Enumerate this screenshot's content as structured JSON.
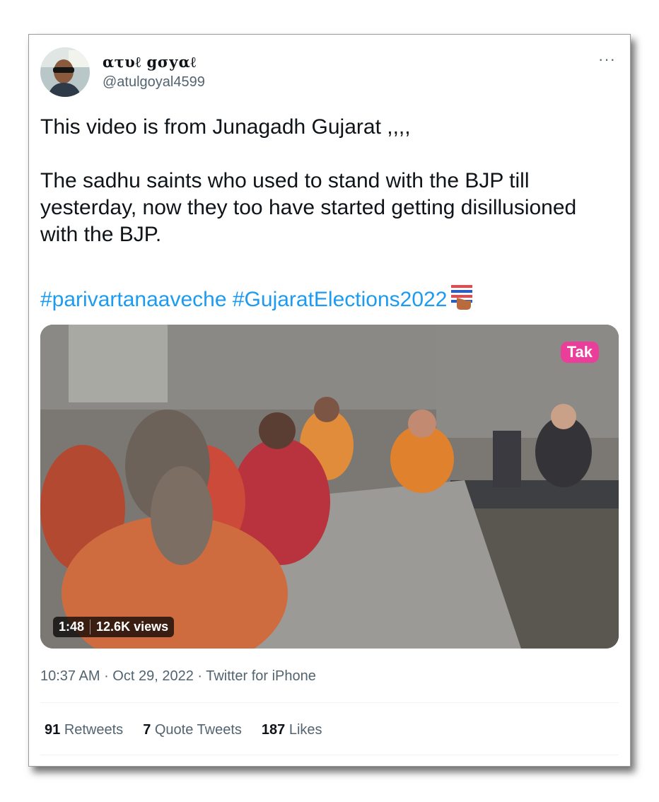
{
  "tweet": {
    "author_name": "ατυℓ gσуαℓ",
    "author_handle": "@atulgoyal4599",
    "more_label": "···",
    "text_lines": [
      "This video is from Junagadh Gujarat ,,,,",
      "The sadhu saints who used to stand with the BJP till yesterday, now they too have started getting disillusioned with the BJP."
    ],
    "hashtags": [
      "#parivartanaaveche",
      "#GujaratElections2022"
    ],
    "media": {
      "duration": "1:48",
      "views": "12.6K views",
      "logo_text": "Tak"
    },
    "time": "10:37 AM",
    "date": "Oct 29, 2022",
    "source": "Twitter for iPhone",
    "stats": {
      "retweets_count": "91",
      "retweets_label": "Retweets",
      "quotes_count": "7",
      "quotes_label": "Quote Tweets",
      "likes_count": "187",
      "likes_label": "Likes"
    }
  },
  "colors": {
    "link": "#1d9bf0",
    "secondary_text": "#536471",
    "primary_text": "#0f1419"
  },
  "icons": [
    "more-icon",
    "ballot-box-icon"
  ]
}
